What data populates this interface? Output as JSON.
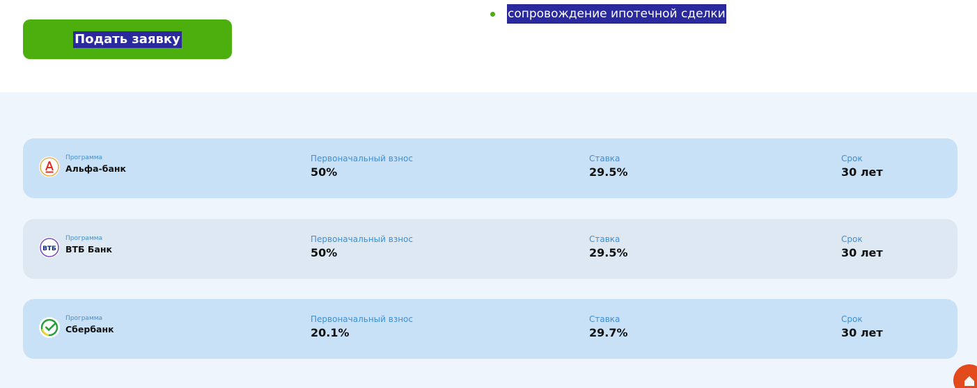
{
  "apply_button": {
    "label": "Подать заявку",
    "color": "#4caf0e"
  },
  "service_bullet": {
    "text": "сопровождение ипотечной сделки"
  },
  "offers": [
    {
      "logo": "alfa-bank-logo",
      "program_label": "Программа",
      "bank": "Альфа-банк",
      "down_payment_label": "Первоначальный взнос",
      "down_payment": "50%",
      "rate_label": "Ставка",
      "rate": "29.5%",
      "term_label": "Срок",
      "term": "30 лет"
    },
    {
      "logo": "vtb-bank-logo",
      "program_label": "Программа",
      "bank": "ВТБ Банк",
      "down_payment_label": "Первоначальный взнос",
      "down_payment": "50%",
      "rate_label": "Ставка",
      "rate": "29.5%",
      "term_label": "Срок",
      "term": "30 лет"
    },
    {
      "logo": "sberbank-logo",
      "program_label": "Программа",
      "bank": "Сбербанк",
      "down_payment_label": "Первоначальный взнос",
      "down_payment": "20.1%",
      "rate_label": "Ставка",
      "rate": "29.7%",
      "term_label": "Срок",
      "term": "30 лет"
    }
  ],
  "vtb_logo_text": "ВТБ",
  "colors": {
    "accent_green": "#4caf0e",
    "label_blue": "#3d8fd6",
    "highlight": "#2a2a9e",
    "corner_widget": "#e24a1c"
  }
}
